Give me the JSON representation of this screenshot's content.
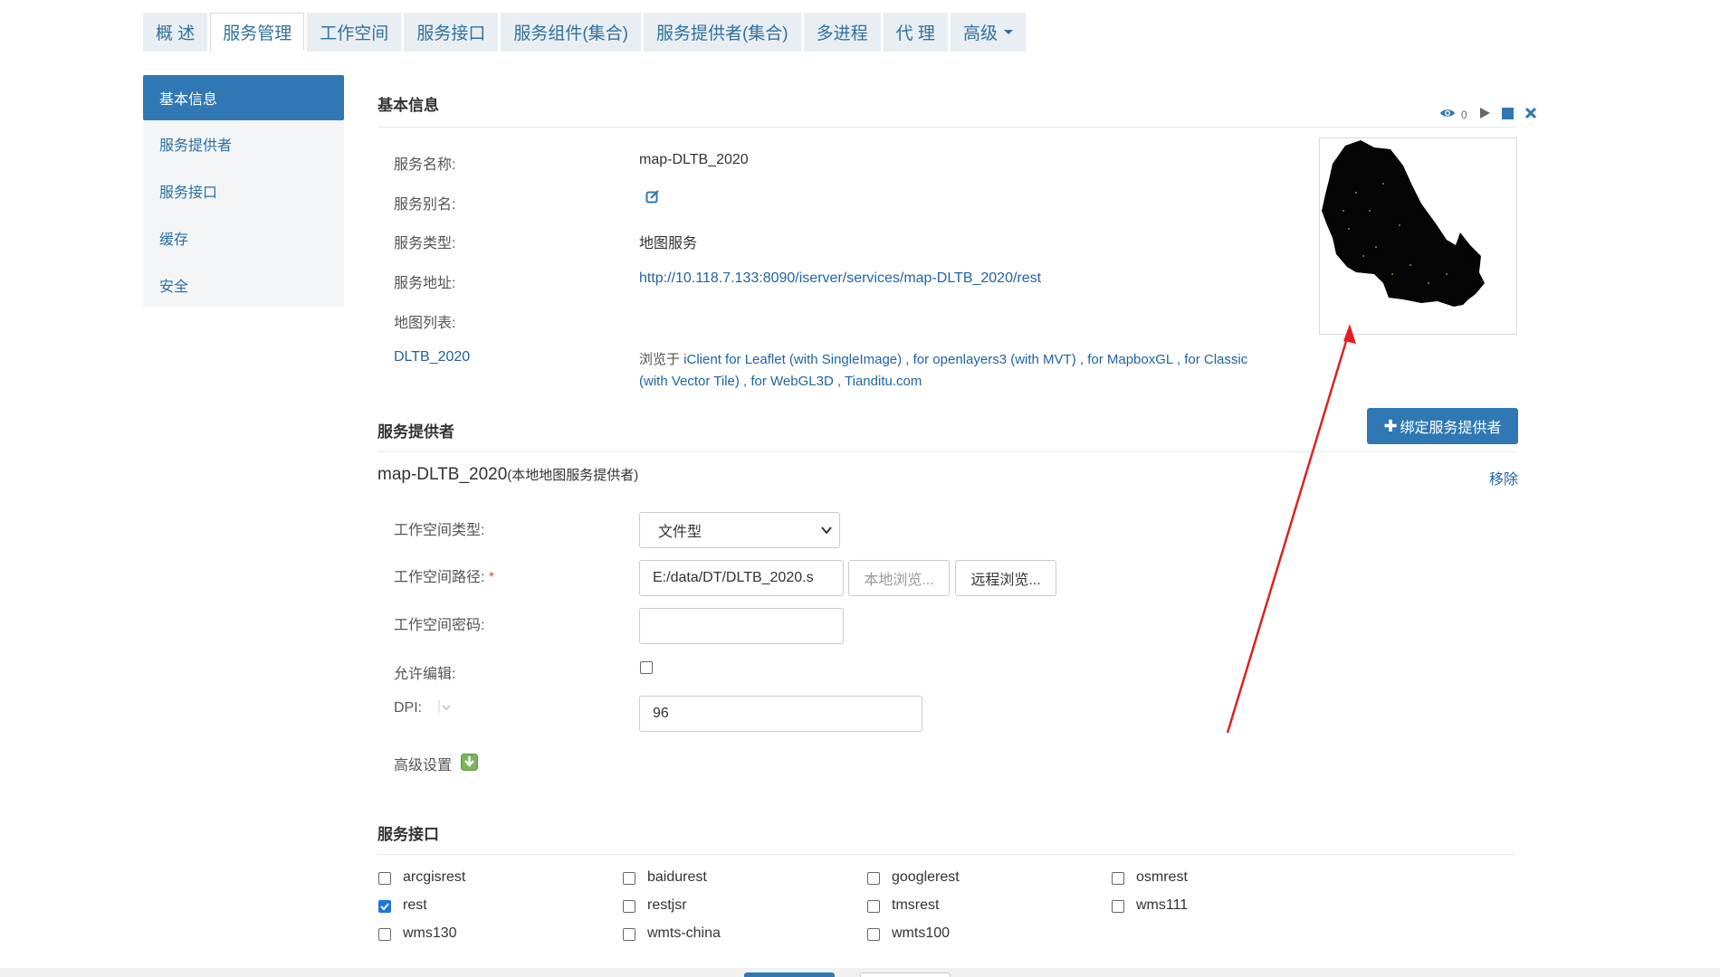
{
  "tabs": [
    "概 述",
    "服务管理",
    "工作空间",
    "服务接口",
    "服务组件(集合)",
    "服务提供者(集合)",
    "多进程",
    "代 理",
    "高级"
  ],
  "active_tab": 1,
  "sidebar": {
    "items": [
      "基本信息",
      "服务提供者",
      "服务接口",
      "缓存",
      "安全"
    ],
    "active": 0
  },
  "basic_info": {
    "title": "基本信息",
    "view_count": "0",
    "name_label": "服务名称:",
    "name_value": "map-DLTB_2020",
    "alias_label": "服务别名:",
    "type_label": "服务类型:",
    "type_value": "地图服务",
    "url_label": "服务地址:",
    "url_value": "http://10.118.7.133:8090/iserver/services/map-DLTB_2020/rest",
    "maplist_label": "地图列表:",
    "map_name": "DLTB_2020",
    "browse_prefix": "浏览于",
    "browse_links_line1": "iClient for Leaflet (with SingleImage) , for openlayers3 (with MVT) , for MapboxGL , for Classic",
    "browse_links_line2": "(with Vector Tile) , for WebGL3D , Tianditu.com"
  },
  "provider": {
    "title": "服务提供者",
    "bind_button": "绑定服务提供者",
    "name": "map-DLTB_2020",
    "name_suffix": "(本地地图服务提供者)",
    "remove": "移除",
    "ws_type_label": "工作空间类型:",
    "ws_type_value": "文件型",
    "ws_path_label": "工作空间路径:",
    "required_mark": "*",
    "ws_path_value": "E:/data/DT/DLTB_2020.s",
    "local_browse": "本地浏览...",
    "remote_browse": "远程浏览...",
    "ws_pwd_label": "工作空间密码:",
    "allow_edit_label": "允许编辑:",
    "dpi_label": "DPI:",
    "dpi_value": "96",
    "advanced_label": "高级设置"
  },
  "interfaces": {
    "title": "服务接口",
    "items": [
      {
        "label": "arcgisrest",
        "checked": false
      },
      {
        "label": "baidurest",
        "checked": false
      },
      {
        "label": "googlerest",
        "checked": false
      },
      {
        "label": "osmrest",
        "checked": false
      },
      {
        "label": "rest",
        "checked": true
      },
      {
        "label": "restjsr",
        "checked": false
      },
      {
        "label": "tmsrest",
        "checked": false
      },
      {
        "label": "wms111",
        "checked": false
      },
      {
        "label": "wms130",
        "checked": false
      },
      {
        "label": "wmts-china",
        "checked": false
      },
      {
        "label": "wmts100",
        "checked": false
      }
    ]
  },
  "colors": {
    "accent": "#2f78b4",
    "link": "#1f64a5",
    "arrow": "#e02020"
  }
}
